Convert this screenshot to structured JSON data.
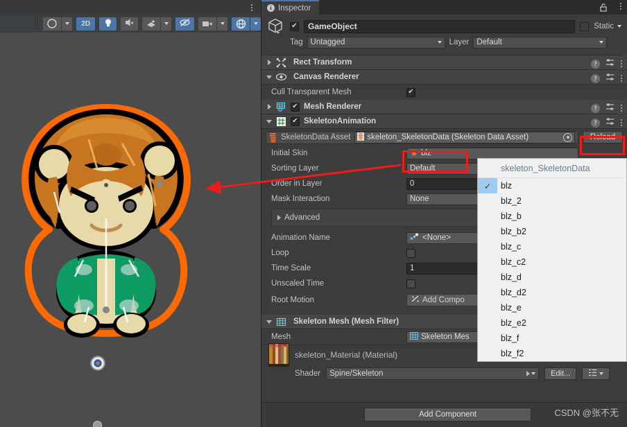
{
  "scene": {
    "kebab_icon": "kebab-menu-icon",
    "toolbar": [
      {
        "name": "draw-mode-dropdown",
        "label": "",
        "icon": "shading-sphere-icon",
        "active": false,
        "arrow": true
      },
      {
        "name": "2d-toggle",
        "label": "2D",
        "icon": "",
        "active": true,
        "arrow": false
      },
      {
        "name": "lighting-toggle",
        "label": "",
        "icon": "lightbulb-icon",
        "active": true,
        "arrow": false
      },
      {
        "name": "audio-toggle",
        "label": "",
        "icon": "speaker-mute-icon",
        "active": false,
        "arrow": false
      },
      {
        "name": "fx-dropdown",
        "label": "",
        "icon": "effects-icon",
        "active": false,
        "arrow": true
      },
      {
        "name": "hidden-objects-toggle",
        "label": "",
        "icon": "eye-slash-icon",
        "active": true,
        "arrow": false
      },
      {
        "name": "camera-dropdown",
        "label": "",
        "icon": "camera-icon",
        "active": false,
        "arrow": true
      },
      {
        "name": "gizmos-dropdown",
        "label": "",
        "icon": "gizmo-globe-icon",
        "active": true,
        "arrow": true
      }
    ]
  },
  "inspector": {
    "tab_label": "Inspector",
    "tab_icon": "info-icon",
    "lock_icon": "lock-open-icon",
    "kebab_icon": "kebab-menu-icon",
    "gameobject": {
      "icon": "cube-icon",
      "enabled": true,
      "name": "GameObject",
      "static_label": "Static",
      "static_checked": false,
      "tag_label": "Tag",
      "tag_value": "Untagged",
      "layer_label": "Layer",
      "layer_value": "Default"
    },
    "components": [
      {
        "name": "Rect Transform",
        "icon": "rect-transform-icon",
        "expanded": false,
        "has_enable_checkbox": false
      },
      {
        "name": "Canvas Renderer",
        "icon": "eye-icon",
        "expanded": true,
        "has_enable_checkbox": false
      },
      {
        "name": "Mesh Renderer",
        "icon": "mesh-renderer-icon",
        "expanded": false,
        "has_enable_checkbox": true,
        "enabled": true
      },
      {
        "name": "SkeletonAnimation",
        "icon": "script-hash-icon",
        "expanded": true,
        "has_enable_checkbox": true,
        "enabled": true
      },
      {
        "name": "Skeleton Mesh (Mesh Filter)",
        "icon": "mesh-filter-icon",
        "expanded": true,
        "has_enable_checkbox": false
      }
    ],
    "canvas_renderer": {
      "cull_label": "Cull Transparent Mesh",
      "cull_checked": true
    },
    "skeleton_animation": {
      "asset_label": "SkeletonData Asset",
      "asset_icon": "spine-icon",
      "asset_value": "skeleton_SkeletonData (Skeleton Data Asset)",
      "asset_value_icon": "skeleton-data-asset-icon",
      "object_picker_icon": "object-picker-icon",
      "reload_label": "Reload",
      "initial_skin_label": "Initial Skin",
      "initial_skin_value": "blz",
      "initial_skin_icon": "skin-icon",
      "sorting_layer_label": "Sorting Layer",
      "sorting_layer_value": "Default",
      "order_in_layer_label": "Order in Layer",
      "order_in_layer_value": "0",
      "mask_interaction_label": "Mask Interaction",
      "mask_interaction_value": "None",
      "advanced_label": "Advanced",
      "animation_name_label": "Animation Name",
      "animation_name_value": "<None>",
      "animation_name_icon": "animation-icon",
      "loop_label": "Loop",
      "loop_checked": false,
      "time_scale_label": "Time Scale",
      "time_scale_value": "1",
      "unscaled_time_label": "Unscaled Time",
      "unscaled_time_checked": false,
      "root_motion_label": "Root Motion",
      "root_motion_button": "Add Compo",
      "root_motion_button_icon": "add-component-icon"
    },
    "mesh_filter": {
      "mesh_label": "Mesh",
      "mesh_value": "Skeleton Mes",
      "mesh_icon": "mesh-icon"
    },
    "material": {
      "title": "skeleton_Material (Material)",
      "thumb_icon": "material-thumbnail-icon",
      "shader_label": "Shader",
      "shader_value": "Spine/Skeleton",
      "edit_label": "Edit...",
      "preset_icon": "preset-list-icon"
    },
    "add_component_label": "Add Component"
  },
  "skin_popup": {
    "header": "skeleton_SkeletonData",
    "selected": "blz",
    "check_icon": "check-icon",
    "items": [
      "blz",
      "blz_2",
      "blz_b",
      "blz_b2",
      "blz_c",
      "blz_c2",
      "blz_d",
      "blz_d2",
      "blz_e",
      "blz_e2",
      "blz_f",
      "blz_f2"
    ]
  },
  "annotations": {
    "highlight_color": "#ee1b1b",
    "boxes": [
      "reload-button",
      "initial-skin-field"
    ],
    "arrow_from": "initial-skin-field",
    "arrow_to": "character-sprite"
  },
  "watermark": "CSDN @张不无",
  "colors": {
    "accent": "#4a77a8",
    "panel_bg": "#3c3c3c",
    "scene_bg": "#4c4c4c",
    "selection_outline": "#ff6a00",
    "popup_bg": "#f0f0f0",
    "popup_selection": "#9fcbef"
  }
}
